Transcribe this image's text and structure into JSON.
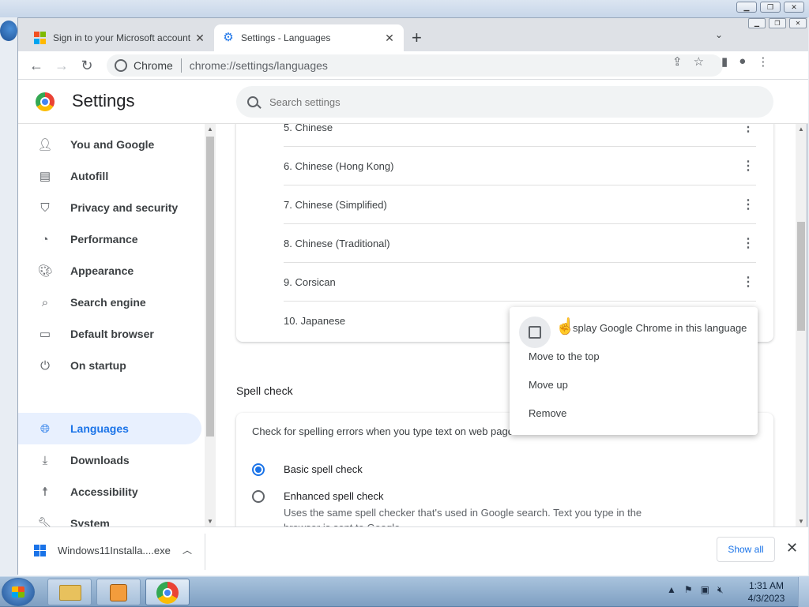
{
  "tabs": [
    {
      "title": "Sign in to your Microsoft account",
      "close": "✕"
    },
    {
      "title": "Settings - Languages",
      "close": "✕"
    }
  ],
  "toolbar": {
    "site_name": "Chrome",
    "url": "chrome://settings/languages"
  },
  "settings": {
    "title": "Settings",
    "search_placeholder": "Search settings"
  },
  "sidebar": {
    "items": [
      {
        "label": "You and Google",
        "icon": "person-icon"
      },
      {
        "label": "Autofill",
        "icon": "clipboard-icon"
      },
      {
        "label": "Privacy and security",
        "icon": "shield-icon"
      },
      {
        "label": "Performance",
        "icon": "gauge-icon"
      },
      {
        "label": "Appearance",
        "icon": "palette-icon"
      },
      {
        "label": "Search engine",
        "icon": "search-icon"
      },
      {
        "label": "Default browser",
        "icon": "browser-icon"
      },
      {
        "label": "On startup",
        "icon": "power-icon"
      },
      {
        "label": "Languages",
        "icon": "globe-icon"
      },
      {
        "label": "Downloads",
        "icon": "download-icon"
      },
      {
        "label": "Accessibility",
        "icon": "accessibility-icon"
      },
      {
        "label": "System",
        "icon": "wrench-icon"
      }
    ]
  },
  "languages": [
    "5. Chinese",
    "6. Chinese (Hong Kong)",
    "7. Chinese (Simplified)",
    "8. Chinese (Traditional)",
    "9. Corsican",
    "10. Japanese"
  ],
  "context_menu": {
    "display_chrome": "Display Google Chrome in this language",
    "display_chrome_visible": "splay Google Chrome in this language",
    "move_top": "Move to the top",
    "move_up": "Move up",
    "remove": "Remove"
  },
  "spell_check": {
    "title": "Spell check",
    "intro": "Check for spelling errors when you type text on web page",
    "basic": "Basic spell check",
    "enhanced": "Enhanced spell check",
    "enhanced_desc": "Uses the same spell checker that's used in Google search. Text you type in the browser is sent to Google."
  },
  "download": {
    "file_name": "Windows11Installa....exe",
    "show_all": "Show all"
  },
  "taskbar": {
    "time": "1:31 AM",
    "date": "4/3/2023"
  },
  "colors": {
    "accent": "#1a73e8",
    "active_bg": "#e8f0fe"
  }
}
